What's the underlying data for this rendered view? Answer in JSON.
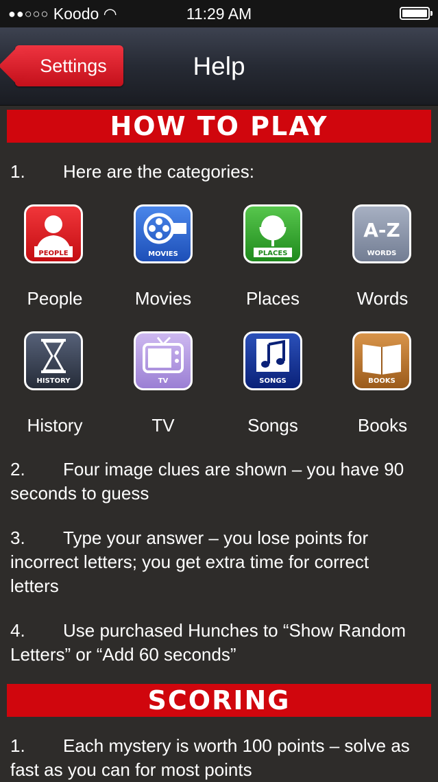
{
  "status": {
    "carrier": "Koodo",
    "time": "11:29 AM"
  },
  "nav": {
    "back_label": "Settings",
    "title": "Help"
  },
  "sections": {
    "how_to_play": "HOW TO PLAY",
    "scoring": "SCORING"
  },
  "steps": [
    {
      "num": "1.",
      "text": "Here are the categories:"
    },
    {
      "num": "2.",
      "text": "Four image clues are shown – you have 90 seconds to guess"
    },
    {
      "num": "3.",
      "text": "Type your answer – you lose points for incorrect letters; you get extra time for correct letters"
    },
    {
      "num": "4.",
      "text": "Use purchased Hunches to “Show Random Letters”  or “Add 60 seconds”"
    }
  ],
  "scoring_steps": [
    {
      "num": "1.",
      "text": "Each mystery is worth 100 points – solve as fast as you can for most points"
    }
  ],
  "categories": [
    {
      "label": "People",
      "badge": "PEOPLE",
      "icon": "person-silhouette-icon",
      "color": "#e01a1f"
    },
    {
      "label": "Movies",
      "badge": "MOVIES",
      "icon": "film-reel-icon",
      "color": "#2a5fc9"
    },
    {
      "label": "Places",
      "badge": "PLACES",
      "icon": "globe-icon",
      "color": "#2e9e2a"
    },
    {
      "label": "Words",
      "badge": "WORDS",
      "icon": "a-z-icon",
      "color": "#8b96ab"
    },
    {
      "label": "History",
      "badge": "HISTORY",
      "icon": "hourglass-icon",
      "color": "#3a4152"
    },
    {
      "label": "TV",
      "badge": "TV",
      "icon": "television-icon",
      "color": "#b49ae0"
    },
    {
      "label": "Songs",
      "badge": "SONGS",
      "icon": "music-note-icon",
      "color": "#102f8e"
    },
    {
      "label": "Books",
      "badge": "BOOKS",
      "icon": "open-book-icon",
      "color": "#b8742b"
    }
  ]
}
